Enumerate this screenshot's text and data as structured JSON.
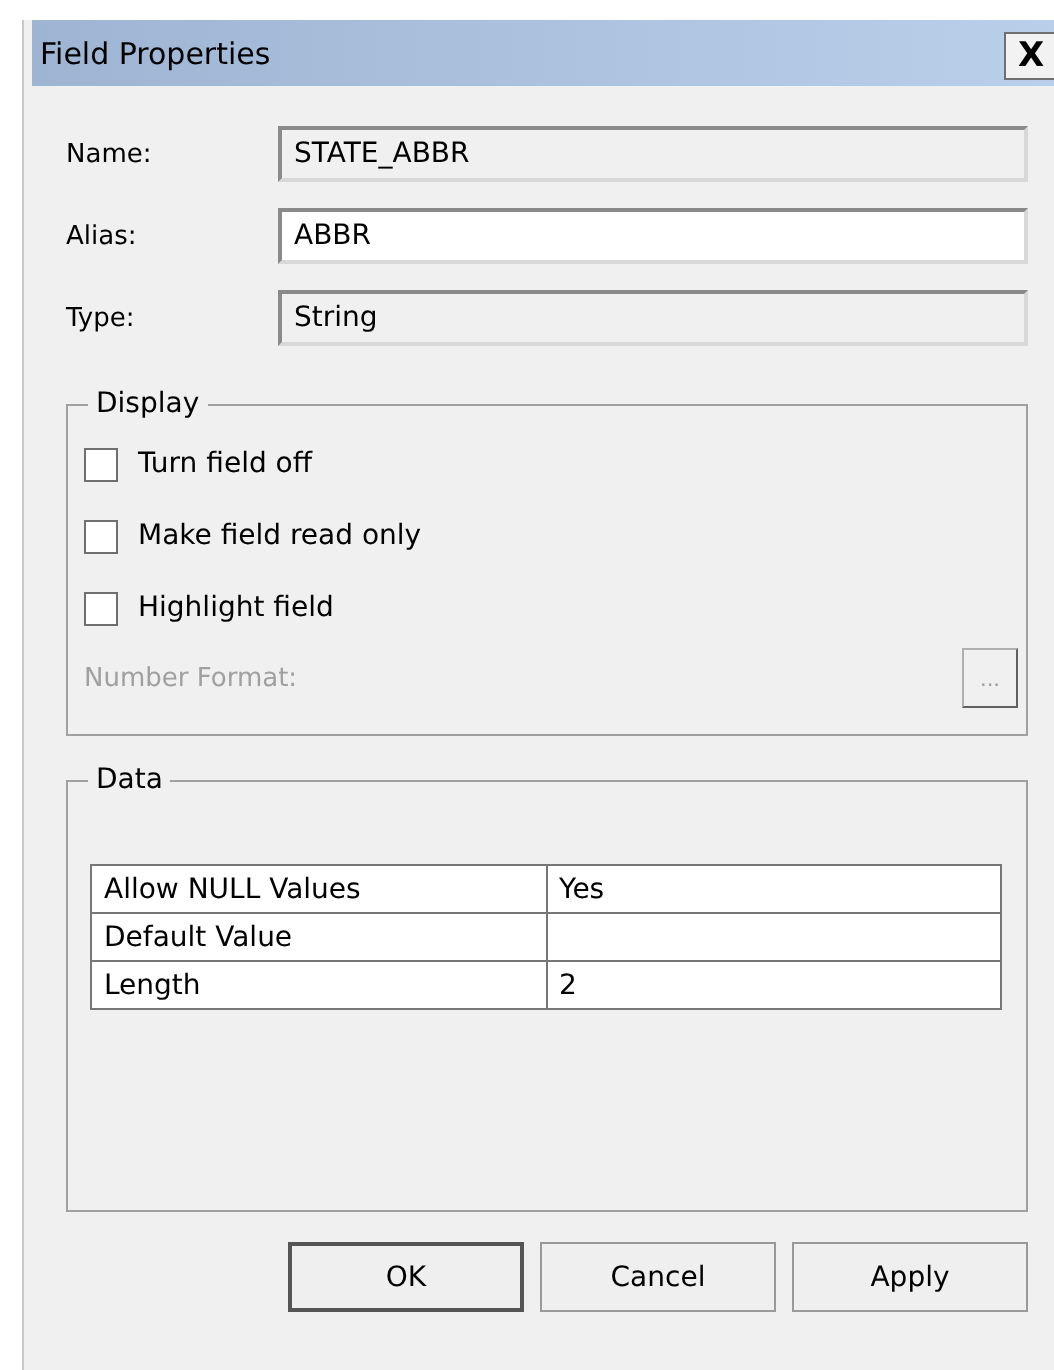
{
  "window": {
    "title": "Field Properties",
    "close": "X"
  },
  "fields": [
    {
      "label": "Name:",
      "value": "STATE_ABBR",
      "kind": "readonly"
    },
    {
      "label": "Alias:",
      "value": "ABBR",
      "kind": "editable"
    },
    {
      "label": "Type:",
      "value": "String",
      "kind": "readonly"
    }
  ],
  "display": {
    "title": "Display",
    "checkboxes": [
      {
        "label": "Turn field off",
        "checked": false
      },
      {
        "label": "Make field read only",
        "checked": false
      },
      {
        "label": "Highlight field",
        "checked": false
      }
    ],
    "number_format": {
      "label": "Number Format:",
      "button": "...",
      "disabled": true
    }
  },
  "data": {
    "title": "Data",
    "rows": [
      [
        "Allow NULL Values",
        "Yes"
      ],
      [
        "Default Value",
        ""
      ],
      [
        "Length",
        "2"
      ]
    ]
  },
  "buttons": [
    {
      "label": "OK",
      "default": true
    },
    {
      "label": "Cancel",
      "default": false
    },
    {
      "label": "Apply",
      "default": false
    }
  ]
}
